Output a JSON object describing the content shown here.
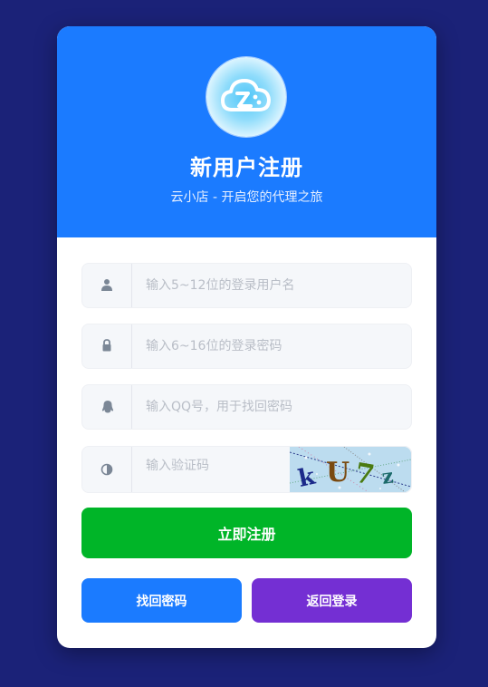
{
  "header": {
    "title": "新用户注册",
    "subtitle": "云小店 - 开启您的代理之旅",
    "logo_icon": "cloud-logo-icon"
  },
  "form": {
    "username": {
      "value": "",
      "placeholder": "输入5~12位的登录用户名",
      "icon": "user-icon"
    },
    "password": {
      "value": "",
      "placeholder": "输入6~16位的登录密码",
      "icon": "lock-icon"
    },
    "qq": {
      "value": "",
      "placeholder": "输入QQ号，用于找回密码",
      "icon": "qq-penguin-icon"
    },
    "captcha": {
      "value": "",
      "placeholder": "输入验证码",
      "icon": "half-circle-icon",
      "image_text": "kU7z"
    }
  },
  "buttons": {
    "register_label": "立即注册",
    "find_password_label": "找回密码",
    "back_login_label": "返回登录"
  },
  "colors": {
    "background": "#1b2278",
    "header": "#1b7bff",
    "register": "#00b528",
    "find_password": "#1b7bff",
    "back_login": "#742fd3"
  }
}
